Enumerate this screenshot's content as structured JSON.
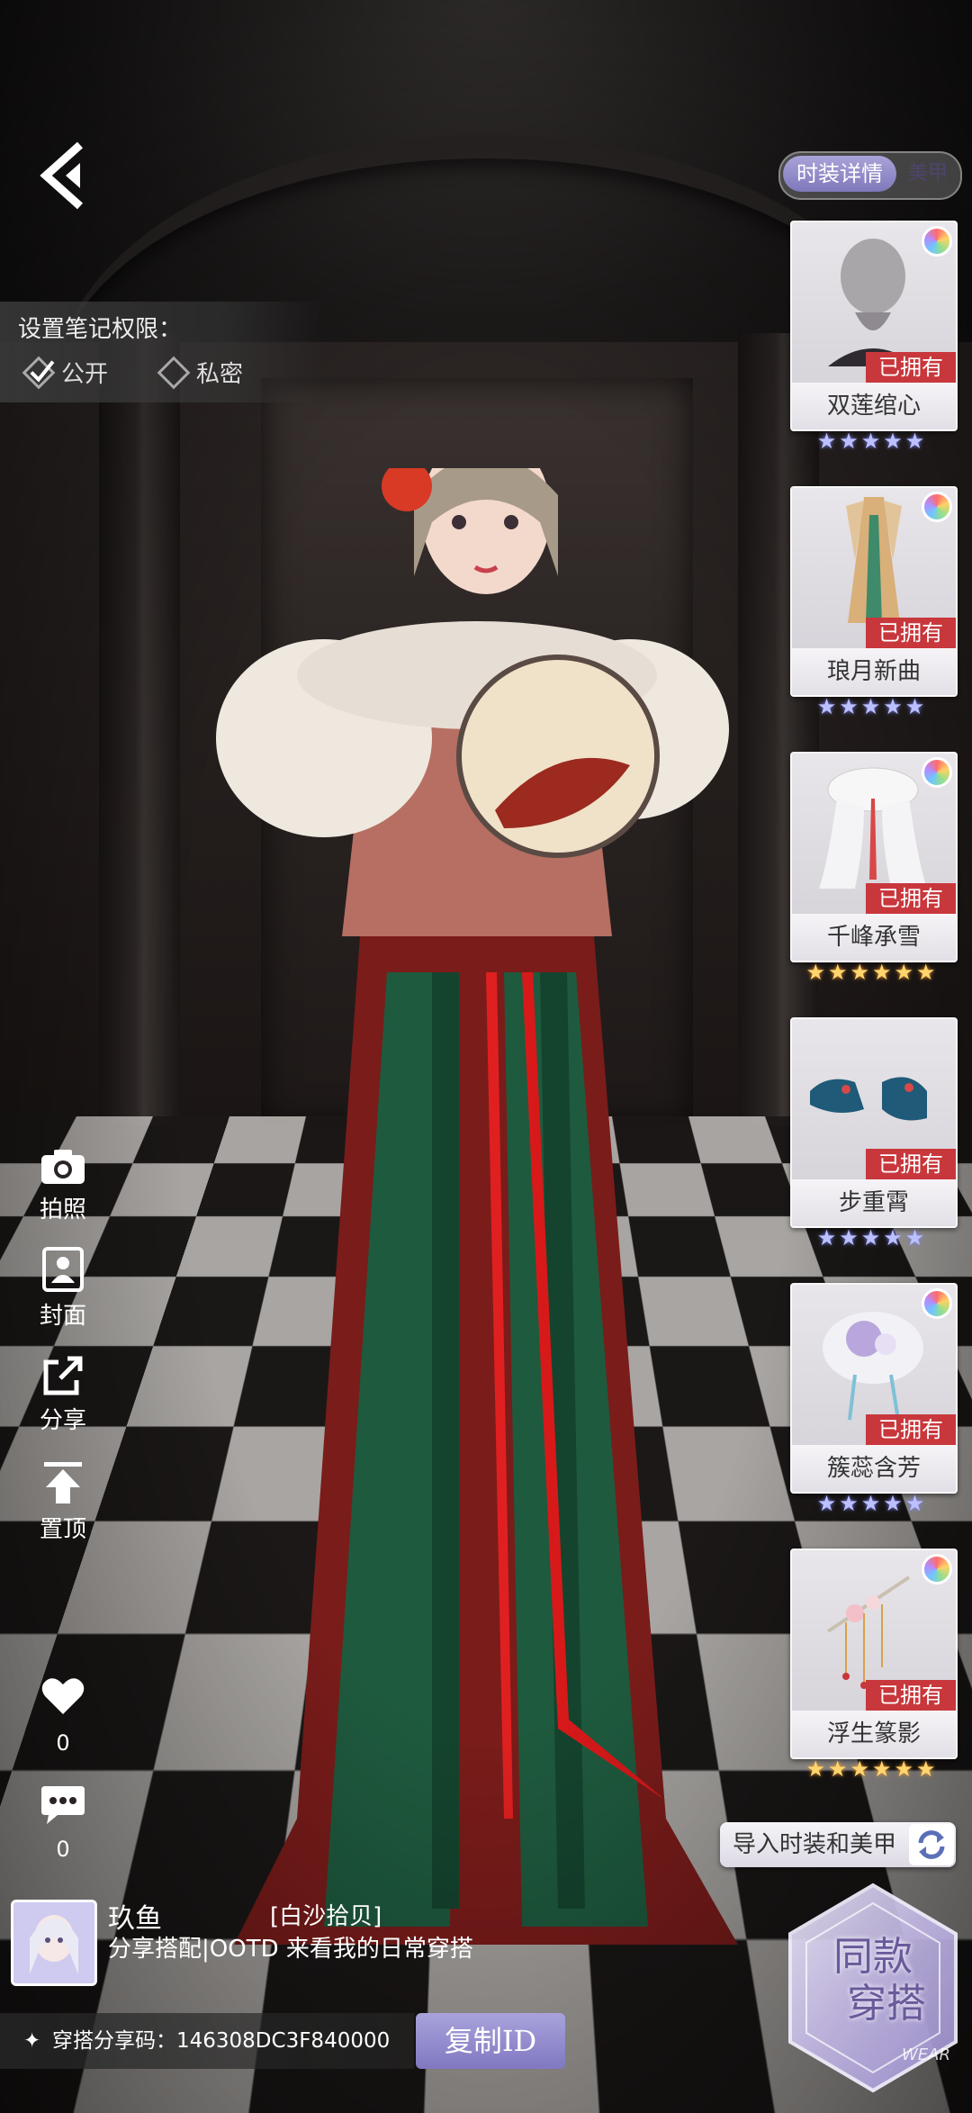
{
  "header": {
    "mode_tabs": [
      "时装详情",
      "美甲"
    ],
    "active_mode": "时装详情"
  },
  "privacy": {
    "title": "设置笔记权限：",
    "options": [
      {
        "label": "公开",
        "checked": true
      },
      {
        "label": "私密",
        "checked": false
      }
    ]
  },
  "side_actions": {
    "photo": "拍照",
    "cover": "封面",
    "share": "分享",
    "pin": "置顶"
  },
  "stats": {
    "likes": "0",
    "comments": "0"
  },
  "items": [
    {
      "name": "双莲绾心",
      "status": "已拥有",
      "stars": "★★★★★",
      "star_color": "silver",
      "dyeable": true
    },
    {
      "name": "琅月新曲",
      "status": "已拥有",
      "stars": "★★★★★",
      "star_color": "silver",
      "dyeable": true
    },
    {
      "name": "千峰承雪",
      "status": "已拥有",
      "stars": "★★★★★★",
      "star_color": "gold",
      "dyeable": true
    },
    {
      "name": "步重霄",
      "status": "已拥有",
      "stars": "★★★★★",
      "star_color": "silver",
      "dyeable": false
    },
    {
      "name": "簇蕊含芳",
      "status": "已拥有",
      "stars": "★★★★★",
      "star_color": "silver",
      "dyeable": true
    },
    {
      "name": "浮生篆影",
      "status": "已拥有",
      "stars": "★★★★★★",
      "star_color": "gold",
      "dyeable": true
    }
  ],
  "import_button": "导入时装和美甲",
  "same_style": {
    "line1": "同款",
    "line2": "穿搭",
    "watermark": "WEAR"
  },
  "user": {
    "name": "玖鱼",
    "tag": "[白沙拾贝]",
    "description": "分享搭配|OOTD 来看我的日常穿搭"
  },
  "share": {
    "code_label": "穿搭分享码：146308DC3F840000",
    "copy_button": "复制ID"
  },
  "colors": {
    "accent": "#8078c0",
    "owned_badge": "#c8373c"
  }
}
